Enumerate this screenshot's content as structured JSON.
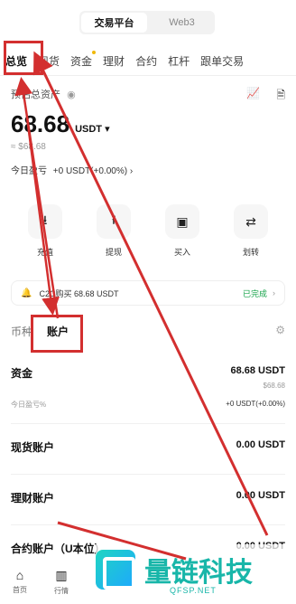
{
  "header": {
    "segments": [
      "交易平台",
      "Web3"
    ]
  },
  "tabs": [
    "总览",
    "现货",
    "资金",
    "理财",
    "合约",
    "杠杆",
    "跟单交易"
  ],
  "summary": {
    "est_label": "预估总资产",
    "balance": "68.68",
    "unit": "USDT",
    "approx": "≈ $68.68",
    "pnl_label": "今日盈亏",
    "pnl_value": "+0 USDT(+0.00%)"
  },
  "actions": [
    {
      "label": "充值",
      "icon": "deposit-icon"
    },
    {
      "label": "提现",
      "icon": "withdraw-icon"
    },
    {
      "label": "买入",
      "icon": "buy-icon"
    },
    {
      "label": "划转",
      "icon": "transfer-icon"
    }
  ],
  "notice": {
    "text": "C2C购买 68.68 USDT",
    "status": "已完成"
  },
  "subtabs": [
    "币种",
    "账户"
  ],
  "funds": {
    "title": "资金",
    "value": "68.68 USDT",
    "approx": "$68.68",
    "pnl_label": "今日盈亏%",
    "pnl_value": "+0 USDT(+0.00%)"
  },
  "accounts": [
    {
      "name": "现货账户",
      "value": "0.00 USDT"
    },
    {
      "name": "理财账户",
      "value": "0.00 USDT"
    },
    {
      "name": "合约账户（U本位）",
      "value": "0.00 USDT"
    }
  ],
  "bottom_nav": [
    {
      "label": "首页",
      "icon": "home-icon"
    },
    {
      "label": "行情",
      "icon": "market-icon"
    }
  ],
  "watermark": {
    "cn": "量链科技",
    "en": "QFSP.NET"
  },
  "colors": {
    "accent": "#f0b90b",
    "success": "#16a34a",
    "annotation": "#d32f2f",
    "watermark": "#18b6a9"
  }
}
